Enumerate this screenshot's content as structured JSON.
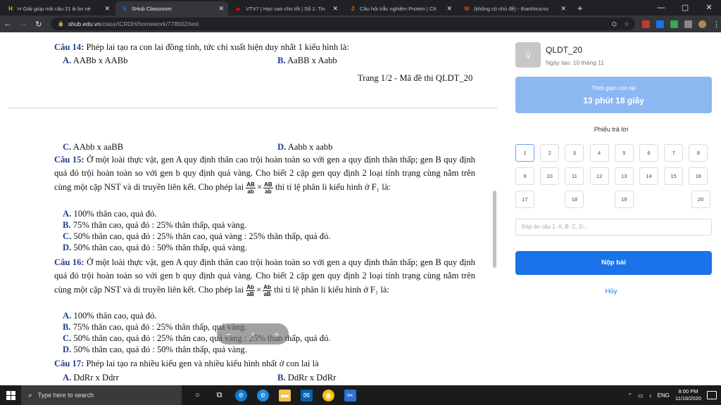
{
  "browser": {
    "tabs": [
      {
        "title": "H Giải giúp mik câu 21 ik bn nè",
        "icon": "H",
        "icon_color": "#f6b400",
        "active": false
      },
      {
        "title": "SHub Classroom",
        "icon": "S",
        "icon_color": "#1a73e8",
        "active": true
      },
      {
        "title": "VTV7 | Học sao cho tốt | Số 1: Tin",
        "icon": "▶",
        "icon_color": "#ff0000",
        "active": false
      },
      {
        "title": "Câu hỏi trắc nghiệm Protein | Ch",
        "icon": "J",
        "icon_color": "#ff7a00",
        "active": false
      },
      {
        "title": "(không có chủ đề) - thanhtrucvo",
        "icon": "M",
        "icon_color": "#ea4335",
        "active": false
      }
    ],
    "new_tab": "+",
    "url_host": "shub.edu.vn",
    "url_path": "/class/ICRDH/homework/778002/test"
  },
  "document": {
    "q14": {
      "num": "Câu 14:",
      "text": "Phép lai tạo ra con lai đồng tính, tức chỉ xuất hiện duy nhất 1 kiểu hình là:"
    },
    "q14_opts": [
      {
        "letter": "A.",
        "text": "AABb x AABb"
      },
      {
        "letter": "B.",
        "text": "AaBB  x Aabb"
      }
    ],
    "page_footer": "Trang 1/2 - Mã đề thi QLDT_20",
    "q14_opts2": [
      {
        "letter": "C.",
        "text": "AAbb x aaBB"
      },
      {
        "letter": "D.",
        "text": "Aabb  x aabb"
      }
    ],
    "q15": {
      "num": "Câu 15:",
      "text": "Ở một loài thực vật, gen A quy định thân cao trội hoàn toàn so với gen a quy định thân thấp; gen B quy định quả đỏ trội hoàn toàn so với gen b quy định quả vàng. Cho biết 2 cặp gen quy định 2 loại tính trạng cùng nằm trên cùng một cặp NST và di truyền liên kết. Cho phép lai",
      "frac1_n": "AB",
      "frac1_d": "ab",
      "frac2_n": "AB",
      "frac2_d": "ab",
      "tail": "thì tỉ lệ phân li kiểu hình ở F₁ là:"
    },
    "q15_opts": [
      {
        "letter": "A.",
        "text": "100% thân cao, quả đỏ."
      },
      {
        "letter": "B.",
        "text": "75% thân cao, quả đỏ : 25% thân thấp, quả vàng."
      },
      {
        "letter": "C.",
        "text": "50% thân cao, quả đỏ : 25% thân cao, quả vàng : 25% thân thấp, quả đỏ."
      },
      {
        "letter": "D.",
        "text": "50% thân cao, quả đỏ : 50% thân thấp, quả vàng."
      }
    ],
    "q16": {
      "num": "Câu 16:",
      "text": "Ở một loài thực vật, gen A quy định thân cao trội hoàn toàn so với gen a quy định thân thấp; gen B quy định quả đỏ trội hoàn toàn so với gen b quy định quả vàng. Cho biết 2 cặp gen quy định 2 loại tính trạng cùng nằm trên cùng một cặp NST và di truyền liên kết. Cho phép lai",
      "frac1_n": "Ab",
      "frac1_d": "aB",
      "frac2_n": "Ab",
      "frac2_d": "aB",
      "tail": "thì tỉ lệ phân li kiểu hình ở F₁ là:"
    },
    "q16_opts": [
      {
        "letter": "A.",
        "text": "100% thân cao, quả đỏ."
      },
      {
        "letter": "B.",
        "text": "75% thân cao, quả đỏ : 25% thân thấp, quả vàng."
      },
      {
        "letter": "C.",
        "text": "50% thân cao, quả đỏ : 25% thân cao, quả vàng : 25% thân thấp, quả đỏ."
      },
      {
        "letter": "D.",
        "text": "50% thân cao, quả đỏ : 50% thân thấp, quả vàng."
      }
    ],
    "q17": {
      "num": "Câu 17:",
      "text": "Phép lai tạo ra nhiều kiểu gen và nhiều kiểu hình nhất ở con lai là"
    },
    "q17_opts": [
      {
        "letter": "A.",
        "text": "DdRr  x Ddrr"
      },
      {
        "letter": "B.",
        "text": "DdRr  x DdRr"
      }
    ],
    "zoom": {
      "minus": "−",
      "plus": "+"
    }
  },
  "panel": {
    "avatar": "Q",
    "title": "QLDT_20",
    "created": "Ngày tạo: 10 tháng 11",
    "timer_label": "Thời gian còn lại",
    "timer_value": "13 phút 18 giây",
    "sheet_title": "Phiếu trả lời",
    "cells": [
      "1",
      "2",
      "3",
      "4",
      "5",
      "6",
      "7",
      "8",
      "9",
      "10",
      "11",
      "12",
      "13",
      "14",
      "15",
      "16",
      "17",
      "18",
      "19",
      "20"
    ],
    "answer_placeholder": "Đáp án câu 1: A, B, C, D...",
    "submit_label": "Nộp bài",
    "cancel_label": "Hủy",
    "accent": "#1a73e8"
  },
  "taskbar": {
    "search_placeholder": "Type here to search",
    "language": "ENG",
    "time": "8:00 PM",
    "date": "11/16/2020"
  }
}
